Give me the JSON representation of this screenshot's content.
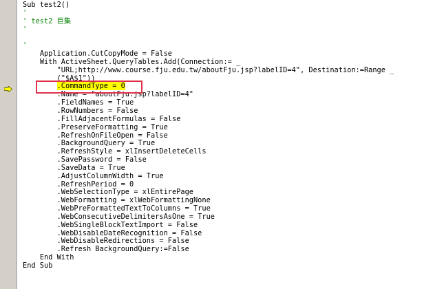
{
  "lines": [
    {
      "indent": "",
      "text": "Sub test2()",
      "kind": "code"
    },
    {
      "indent": "",
      "text": "'",
      "kind": "comment"
    },
    {
      "indent": "",
      "text": "' test2 巨集",
      "kind": "comment"
    },
    {
      "indent": "",
      "text": "'",
      "kind": "comment"
    },
    {
      "indent": "",
      "text": "",
      "kind": "code"
    },
    {
      "indent": "",
      "text": "'",
      "kind": "comment"
    },
    {
      "indent": "    ",
      "text": "Application.CutCopyMode = False",
      "kind": "code"
    },
    {
      "indent": "    ",
      "text": "With ActiveSheet.QueryTables.Add(Connection:= _",
      "kind": "code"
    },
    {
      "indent": "        ",
      "text": "\"URL;http://www.course.fju.edu.tw/aboutFju.jsp?labelID=4\", Destination:=Range _",
      "kind": "code"
    },
    {
      "indent": "        ",
      "text": "(\"$A$1\"))",
      "kind": "code"
    },
    {
      "indent": "        ",
      "text": ".CommandType = 0",
      "kind": "current"
    },
    {
      "indent": "        ",
      "text": ".Name = \"aboutFju.jsp?labelID=4\"",
      "kind": "code"
    },
    {
      "indent": "        ",
      "text": ".FieldNames = True",
      "kind": "code"
    },
    {
      "indent": "        ",
      "text": ".RowNumbers = False",
      "kind": "code"
    },
    {
      "indent": "        ",
      "text": ".FillAdjacentFormulas = False",
      "kind": "code"
    },
    {
      "indent": "        ",
      "text": ".PreserveFormatting = True",
      "kind": "code"
    },
    {
      "indent": "        ",
      "text": ".RefreshOnFileOpen = False",
      "kind": "code"
    },
    {
      "indent": "        ",
      "text": ".BackgroundQuery = True",
      "kind": "code"
    },
    {
      "indent": "        ",
      "text": ".RefreshStyle = xlInsertDeleteCells",
      "kind": "code"
    },
    {
      "indent": "        ",
      "text": ".SavePassword = False",
      "kind": "code"
    },
    {
      "indent": "        ",
      "text": ".SaveData = True",
      "kind": "code"
    },
    {
      "indent": "        ",
      "text": ".AdjustColumnWidth = True",
      "kind": "code"
    },
    {
      "indent": "        ",
      "text": ".RefreshPeriod = 0",
      "kind": "code"
    },
    {
      "indent": "        ",
      "text": ".WebSelectionType = xlEntirePage",
      "kind": "code"
    },
    {
      "indent": "        ",
      "text": ".WebFormatting = xlWebFormattingNone",
      "kind": "code"
    },
    {
      "indent": "        ",
      "text": ".WebPreFormattedTextToColumns = True",
      "kind": "code"
    },
    {
      "indent": "        ",
      "text": ".WebConsecutiveDelimitersAsOne = True",
      "kind": "code"
    },
    {
      "indent": "        ",
      "text": ".WebSingleBlockTextImport = False",
      "kind": "code"
    },
    {
      "indent": "        ",
      "text": ".WebDisableDateRecognition = False",
      "kind": "code"
    },
    {
      "indent": "        ",
      "text": ".WebDisableRedirections = False",
      "kind": "code"
    },
    {
      "indent": "        ",
      "text": ".Refresh BackgroundQuery:=False",
      "kind": "code"
    },
    {
      "indent": "    ",
      "text": "End With",
      "kind": "code"
    },
    {
      "indent": "",
      "text": "End Sub",
      "kind": "code"
    }
  ],
  "gutter": {
    "current_line_icon": "execution-arrow-icon",
    "arrow_color": "#ffff00"
  },
  "colors": {
    "comment": "#008000",
    "highlight": "#ffff00",
    "annotation_box": "#e0304a"
  }
}
